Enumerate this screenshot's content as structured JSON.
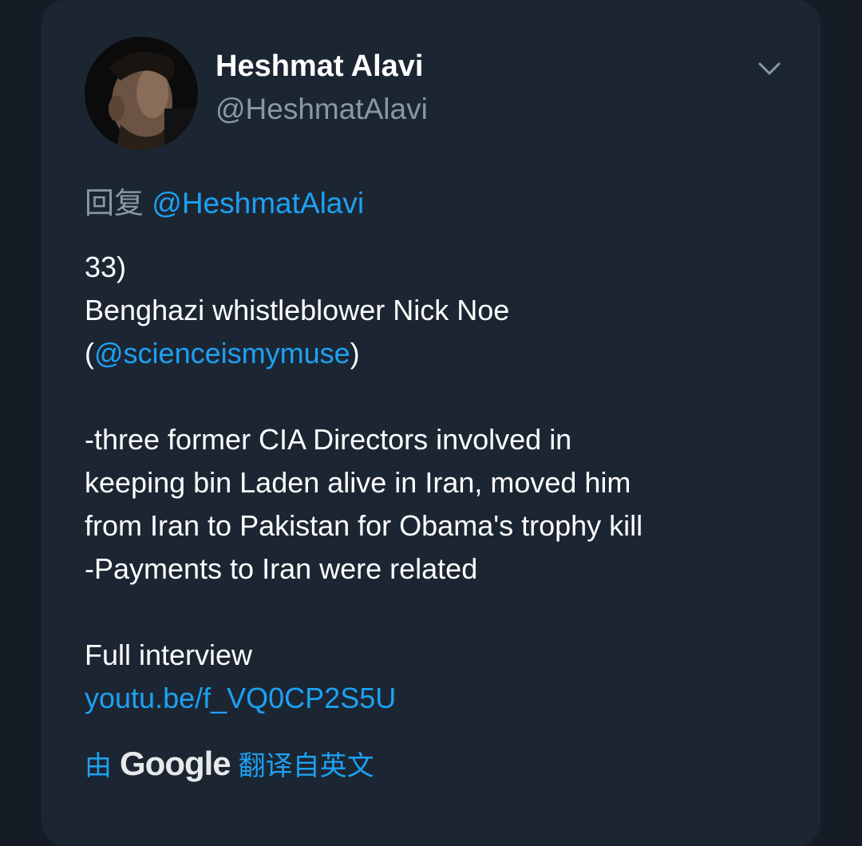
{
  "tweet": {
    "author": {
      "name": "Heshmat Alavi",
      "handle": "@HeshmatAlavi",
      "avatar_icon": "avatar-photo"
    },
    "menu_icon": "chevron-down-icon",
    "reply": {
      "prefix": "回复",
      "mention": "@HeshmatAlavi"
    },
    "body": {
      "line1": "33)",
      "line2": "Benghazi whistleblower Nick Noe",
      "line3_open": "(",
      "line3_mention": "@scienceismymuse",
      "line3_close": ")",
      "line4": "-three former CIA Directors involved in",
      "line5": "keeping bin Laden alive in Iran, moved him",
      "line6": "from Iran to Pakistan for Obama's trophy kill",
      "line7": "-Payments to Iran were related",
      "line8": "Full interview",
      "link": "youtu.be/f_VQ0CP2S5U"
    },
    "translation": {
      "by": "由",
      "provider": "Google",
      "action": "翻译自英文"
    }
  },
  "colors": {
    "background": "#151c25",
    "card": "#1c2633",
    "link": "#1da1f2",
    "secondary_text": "#8899a6",
    "primary_text": "#ffffff"
  }
}
